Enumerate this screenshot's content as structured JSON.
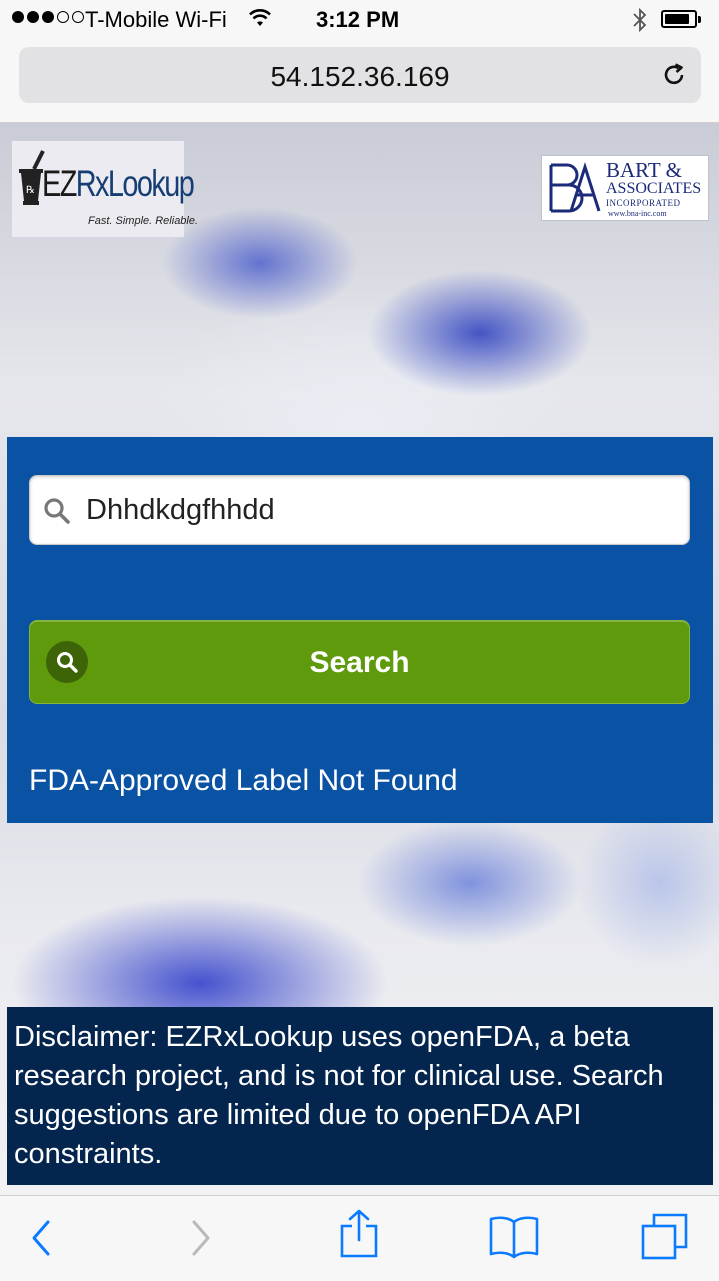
{
  "status_bar": {
    "signal_bars_filled": 3,
    "signal_bars_total": 5,
    "carrier": "T-Mobile Wi-Fi",
    "time": "3:12 PM",
    "battery_level": 0.85
  },
  "browser": {
    "url": "54.152.36.169"
  },
  "header": {
    "ez_logo": {
      "prefix": "EZ",
      "suffix": "RxLookup",
      "tagline": "Fast. Simple. Reliable."
    },
    "partner_logo": {
      "line1": "BART &",
      "line2": "ASSOCIATES",
      "line3": "INCORPORATED",
      "line4": "www.bna-inc.com"
    }
  },
  "search": {
    "input_value": "Dhhdkdgfhhdd",
    "button_label": "Search",
    "result_message": "FDA-Approved Label Not Found"
  },
  "disclaimer": {
    "text": "Disclaimer: EZRxLookup uses openFDA, a beta research project, and is not for clinical use. Search suggestions are limited due to openFDA API constraints."
  },
  "colors": {
    "panel_blue": "#0a52a3",
    "button_green": "#5e9a0c",
    "disclaimer_navy": "#04254d",
    "ios_blue": "#0a7aff"
  },
  "toolbar": {
    "icons": [
      "back-icon",
      "forward-icon",
      "share-icon",
      "bookmarks-icon",
      "tabs-icon"
    ]
  }
}
